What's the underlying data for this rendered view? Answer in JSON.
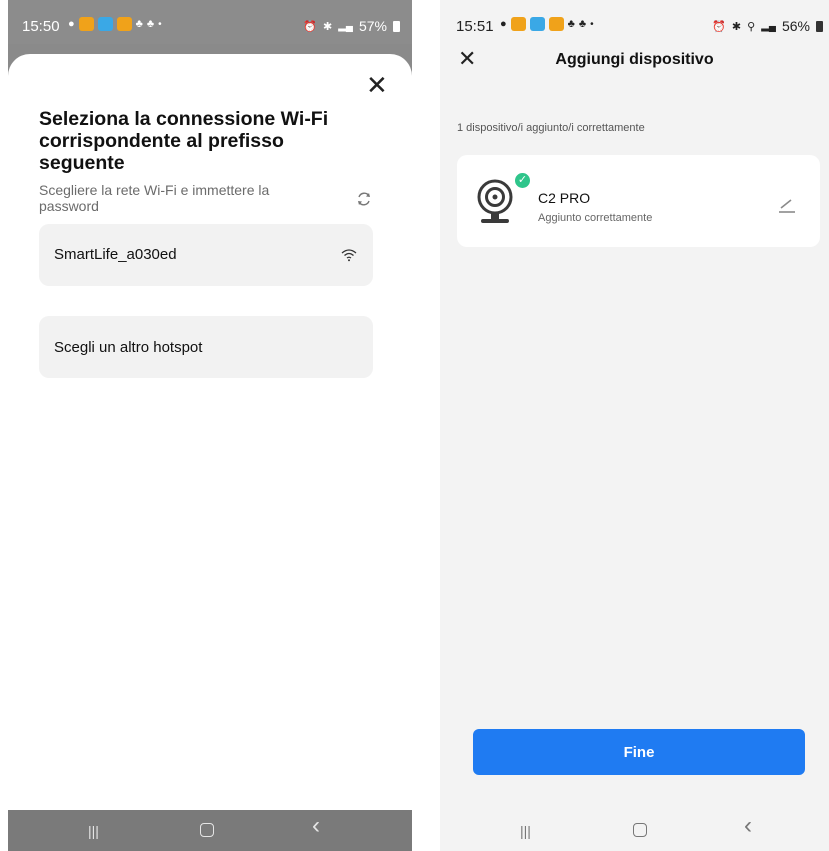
{
  "left_screen": {
    "status_bar": {
      "time": "15:50",
      "battery": "57%"
    },
    "close_icon": "close-icon",
    "title": "Seleziona la connessione Wi-Fi corrispondente al prefisso seguente",
    "subtitle": "Scegliere la rete Wi-Fi e immettere la password",
    "networks": [
      {
        "ssid": "SmartLife_a030ed",
        "icon": "wifi-icon"
      }
    ],
    "other_hotspot_label": "Scegli un altro hotspot",
    "nav_bar": {
      "recents": "|||",
      "home": "○",
      "back": "‹"
    }
  },
  "right_screen": {
    "status_bar": {
      "time": "15:51",
      "battery": "56%"
    },
    "header": {
      "title": "Aggiungi dispositivo",
      "close_icon": "close-icon"
    },
    "success_count": "1 dispositivo/i aggiunto/i correttamente",
    "device": {
      "name": "C2 PRO",
      "status": "Aggiunto correttamente",
      "icon": "camera-icon",
      "edit_icon": "edit-icon"
    },
    "done_button": "Fine",
    "nav_bar": {
      "recents": "|||",
      "home": "○",
      "back": "‹"
    }
  },
  "colors": {
    "primary": "#1f7bf2",
    "success_check": "#2fc58b",
    "card_bg": "#f2f2f2"
  }
}
